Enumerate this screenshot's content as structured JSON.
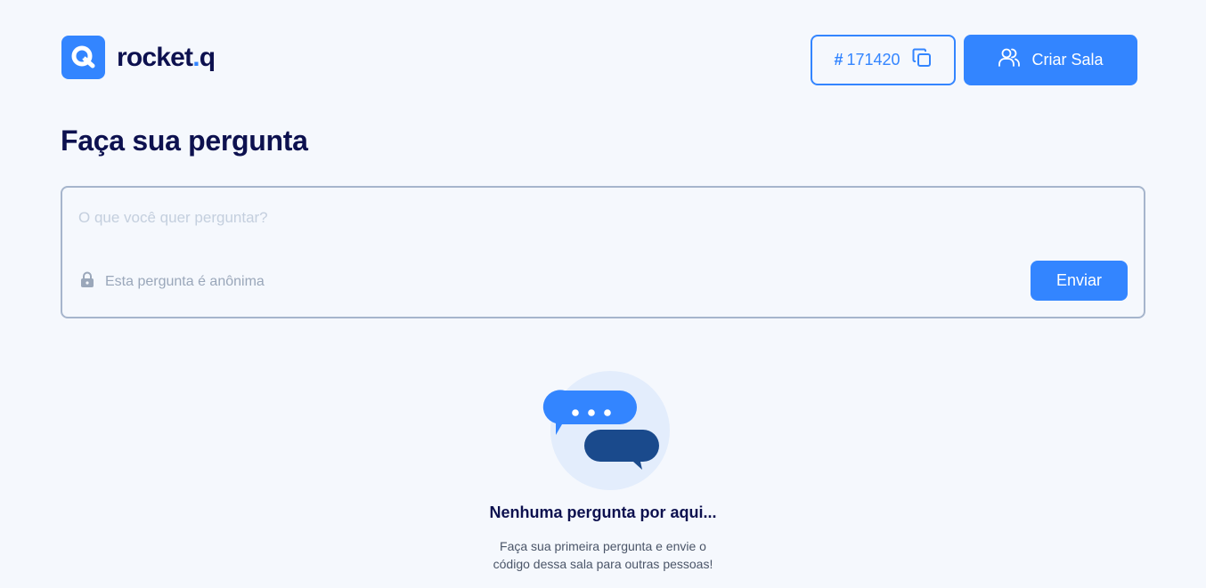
{
  "logo": {
    "text": "rocket",
    "dot": ".",
    "suffix": "q"
  },
  "header": {
    "room_hash": "#",
    "room_code": "171420",
    "create_room_label": "Criar Sala"
  },
  "main": {
    "title": "Faça sua pergunta",
    "question_placeholder": "O que você quer perguntar?",
    "anonymous_label": "Esta pergunta é anônima",
    "send_label": "Enviar"
  },
  "empty_state": {
    "title": "Nenhuma pergunta por aqui...",
    "line1": "Faça sua primeira pergunta e envie o",
    "line2": "código dessa sala para outras pessoas!"
  },
  "icons": {
    "logo": "search-bubble-icon",
    "copy": "copy-icon",
    "users": "users-icon",
    "lock": "lock-icon",
    "chat": "chat-bubbles-icon"
  },
  "colors": {
    "accent": "#3385FF",
    "title": "#0D114F",
    "background": "#F5F8FD",
    "border": "#A6B5CC",
    "muted": "#9AA7BA"
  }
}
